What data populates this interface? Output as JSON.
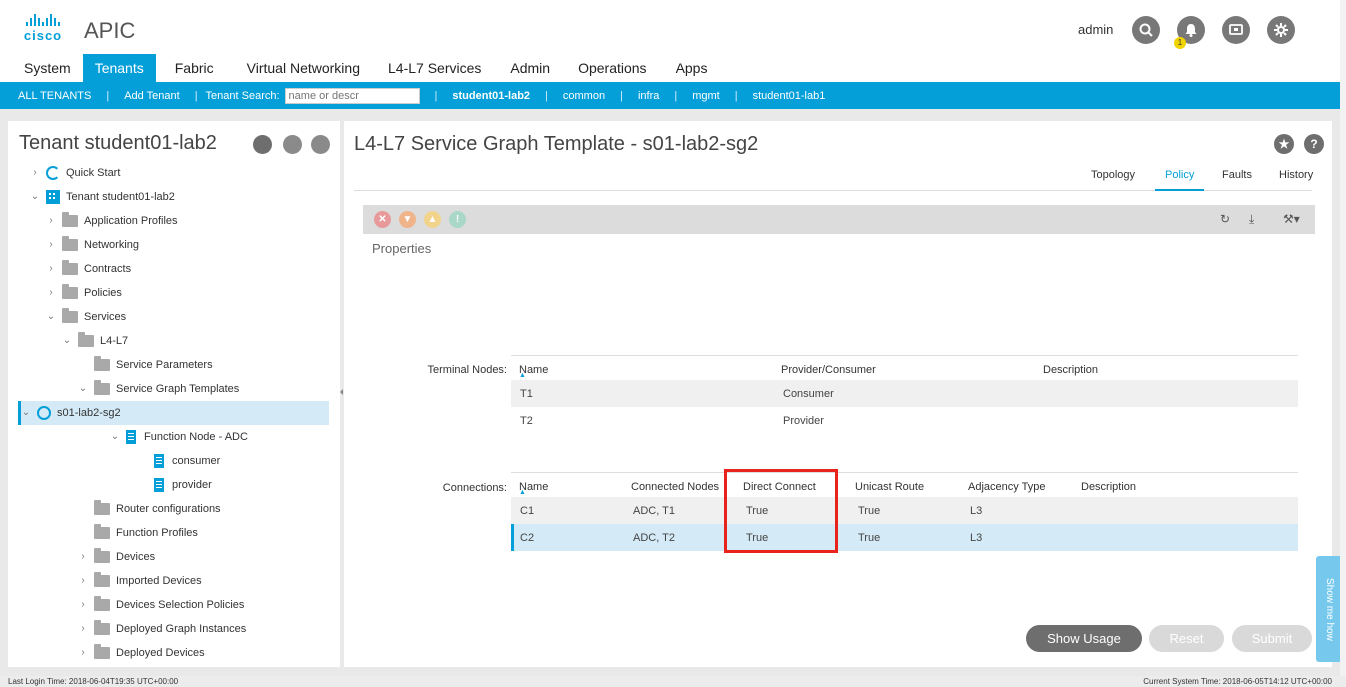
{
  "header": {
    "logo_text": "cisco",
    "app_name": "APIC",
    "user": "admin",
    "notification_count": "1",
    "icons": [
      "search-icon",
      "bell-icon",
      "monitor-icon",
      "gear-icon"
    ]
  },
  "nav": {
    "tabs": [
      "System",
      "Tenants",
      "Fabric",
      "Virtual Networking",
      "L4-L7 Services",
      "Admin",
      "Operations",
      "Apps"
    ],
    "active": "Tenants"
  },
  "subnav": {
    "all_tenants": "ALL TENANTS",
    "add_tenant": "Add Tenant",
    "search_label": "Tenant Search:",
    "search_placeholder": "name or descr",
    "tenants": [
      "student01-lab2",
      "common",
      "infra",
      "mgmt",
      "student01-lab1"
    ],
    "current": "student01-lab2"
  },
  "left": {
    "title": "Tenant student01-lab2",
    "tree": [
      {
        "label": "Quick Start",
        "chev": "›",
        "icon": "quick-start-icon"
      },
      {
        "label": "Tenant student01-lab2",
        "chev": "⌄",
        "icon": "tenant-icon"
      },
      {
        "label": "Application Profiles",
        "chev": "›",
        "icon": "folder-icon"
      },
      {
        "label": "Networking",
        "chev": "›",
        "icon": "folder-icon"
      },
      {
        "label": "Contracts",
        "chev": "›",
        "icon": "folder-icon"
      },
      {
        "label": "Policies",
        "chev": "›",
        "icon": "folder-icon"
      },
      {
        "label": "Services",
        "chev": "⌄",
        "icon": "folder-icon"
      },
      {
        "label": "L4-L7",
        "chev": "⌄",
        "icon": "folder-icon"
      },
      {
        "label": "Service Parameters",
        "chev": "",
        "icon": "folder-icon"
      },
      {
        "label": "Service Graph Templates",
        "chev": "⌄",
        "icon": "folder-icon"
      },
      {
        "label": "s01-lab2-sg2",
        "chev": "⌄",
        "icon": "service-graph-icon"
      },
      {
        "label": "Function Node - ADC",
        "chev": "⌄",
        "icon": "document-icon"
      },
      {
        "label": "consumer",
        "chev": "",
        "icon": "document-icon"
      },
      {
        "label": "provider",
        "chev": "",
        "icon": "document-icon"
      },
      {
        "label": "Router configurations",
        "chev": "",
        "icon": "folder-icon"
      },
      {
        "label": "Function Profiles",
        "chev": "",
        "icon": "folder-icon"
      },
      {
        "label": "Devices",
        "chev": "›",
        "icon": "folder-icon"
      },
      {
        "label": "Imported Devices",
        "chev": "›",
        "icon": "folder-icon"
      },
      {
        "label": "Devices Selection Policies",
        "chev": "›",
        "icon": "folder-icon"
      },
      {
        "label": "Deployed Graph Instances",
        "chev": "›",
        "icon": "folder-icon"
      },
      {
        "label": "Deployed Devices",
        "chev": "›",
        "icon": "folder-icon"
      }
    ]
  },
  "main": {
    "title": "L4-L7 Service Graph Template - s01-lab2-sg2",
    "tabs": [
      "Topology",
      "Policy",
      "Faults",
      "History"
    ],
    "active_tab": "Policy",
    "properties_label": "Properties",
    "terminal_nodes": {
      "label": "Terminal Nodes:",
      "columns": [
        "Name",
        "Provider/Consumer",
        "Description"
      ],
      "rows": [
        [
          "T1",
          "Consumer",
          ""
        ],
        [
          "T2",
          "Provider",
          ""
        ]
      ]
    },
    "connections": {
      "label": "Connections:",
      "columns": [
        "Name",
        "Connected Nodes",
        "Direct Connect",
        "Unicast Route",
        "Adjacency Type",
        "Description"
      ],
      "rows": [
        [
          "C1",
          "ADC, T1",
          "True",
          "True",
          "L3",
          ""
        ],
        [
          "C2",
          "ADC, T2",
          "True",
          "True",
          "L3",
          ""
        ]
      ]
    },
    "buttons": {
      "show_usage": "Show Usage",
      "reset": "Reset",
      "submit": "Submit"
    }
  },
  "show_me_how": "Show me how",
  "footer": {
    "last_login": "Last Login Time: 2018-06-04T19:35 UTC+00:00",
    "current_time": "Current System Time: 2018-06-05T14:12 UTC+00:00"
  },
  "colors": {
    "accent": "#049fd9",
    "highlight": "#e8231c"
  }
}
